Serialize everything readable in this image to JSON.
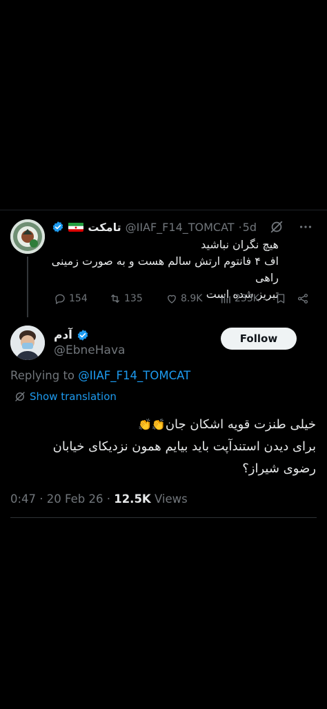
{
  "parent_tweet": {
    "display_name": "تامکت",
    "handle": "@IIAF_F14_TOMCAT",
    "separator": "·",
    "age": "5d",
    "text_lines": [
      "هیچ نگران نباشید",
      "اف ۴ فانتوم ارتش سالم هست و به صورت زمینی راهی",
      "تبریز شده است"
    ],
    "stats": {
      "replies": "154",
      "reposts": "135",
      "likes": "8.9K",
      "views": "233K"
    }
  },
  "main_tweet": {
    "display_name": "آدم",
    "handle": "@EbneHava",
    "follow_label": "Follow",
    "replying_prefix": "Replying to ",
    "replying_to": "@IIAF_F14_TOMCAT",
    "translate_label": "Show translation",
    "line1_text": "خیلی طنزت قویه اشکان جان",
    "line2_text": "برای دیدن استندآپت باید بیایم همون نزدیکای خیابان",
    "line3_text": "رضوی شیراز؟",
    "clap_emoji": "👏👏",
    "time": "0:47 · 20 Feb 26 · ",
    "views_count": "12.5K",
    "views_label": " Views"
  },
  "colors": {
    "background": "#000000",
    "text": "#e7e9ea",
    "muted": "#71767b",
    "link": "#1d9bf0",
    "verified": "#1d9bf0"
  },
  "icons": [
    "verified-badge-icon",
    "iran-flag-icon",
    "grok-icon",
    "more-icon",
    "reply-icon",
    "repost-icon",
    "like-icon",
    "views-icon",
    "bookmark-icon",
    "share-icon",
    "translate-icon"
  ]
}
